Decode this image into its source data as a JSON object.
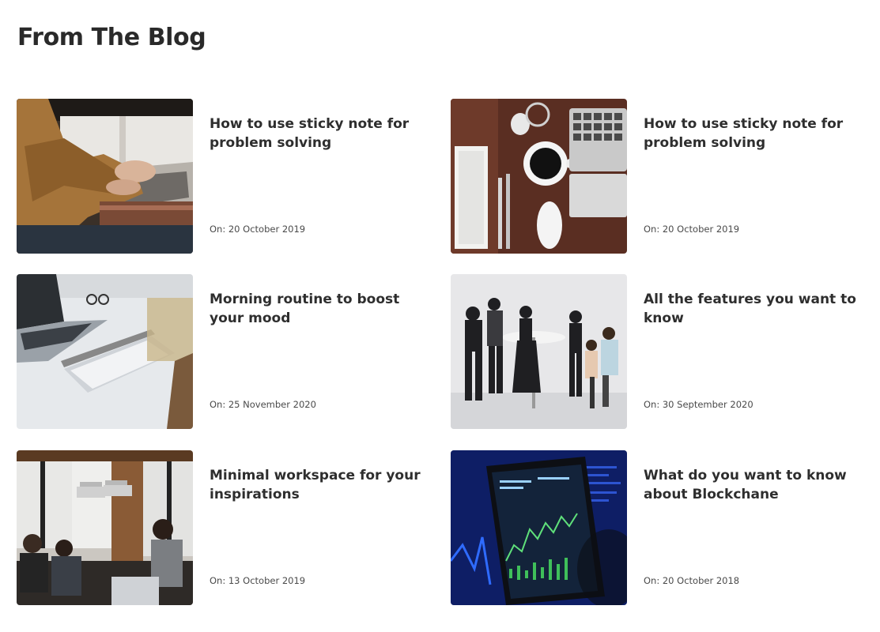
{
  "section": {
    "heading": "From The Blog"
  },
  "posts": [
    {
      "title": "How to use sticky note for problem solving",
      "date": "On: 20 October 2019",
      "image": "laptop-typing-photo"
    },
    {
      "title": "How to use sticky note for problem solving",
      "date": "On: 20 October 2019",
      "image": "desk-coffee-keyboard-photo"
    },
    {
      "title": "Morning routine to boost your mood",
      "date": "On: 25 November 2020",
      "image": "desk-laptop-notebook-photo"
    },
    {
      "title": "All the features you want to know",
      "date": "On: 30 September 2020",
      "image": "team-meeting-photo"
    },
    {
      "title": "Minimal workspace for your inspirations",
      "date": "On: 13 October 2019",
      "image": "coworking-space-photo"
    },
    {
      "title": "What do you want to know about Blockchane",
      "date": "On: 20 October 2018",
      "image": "phone-stock-chart-photo"
    }
  ]
}
